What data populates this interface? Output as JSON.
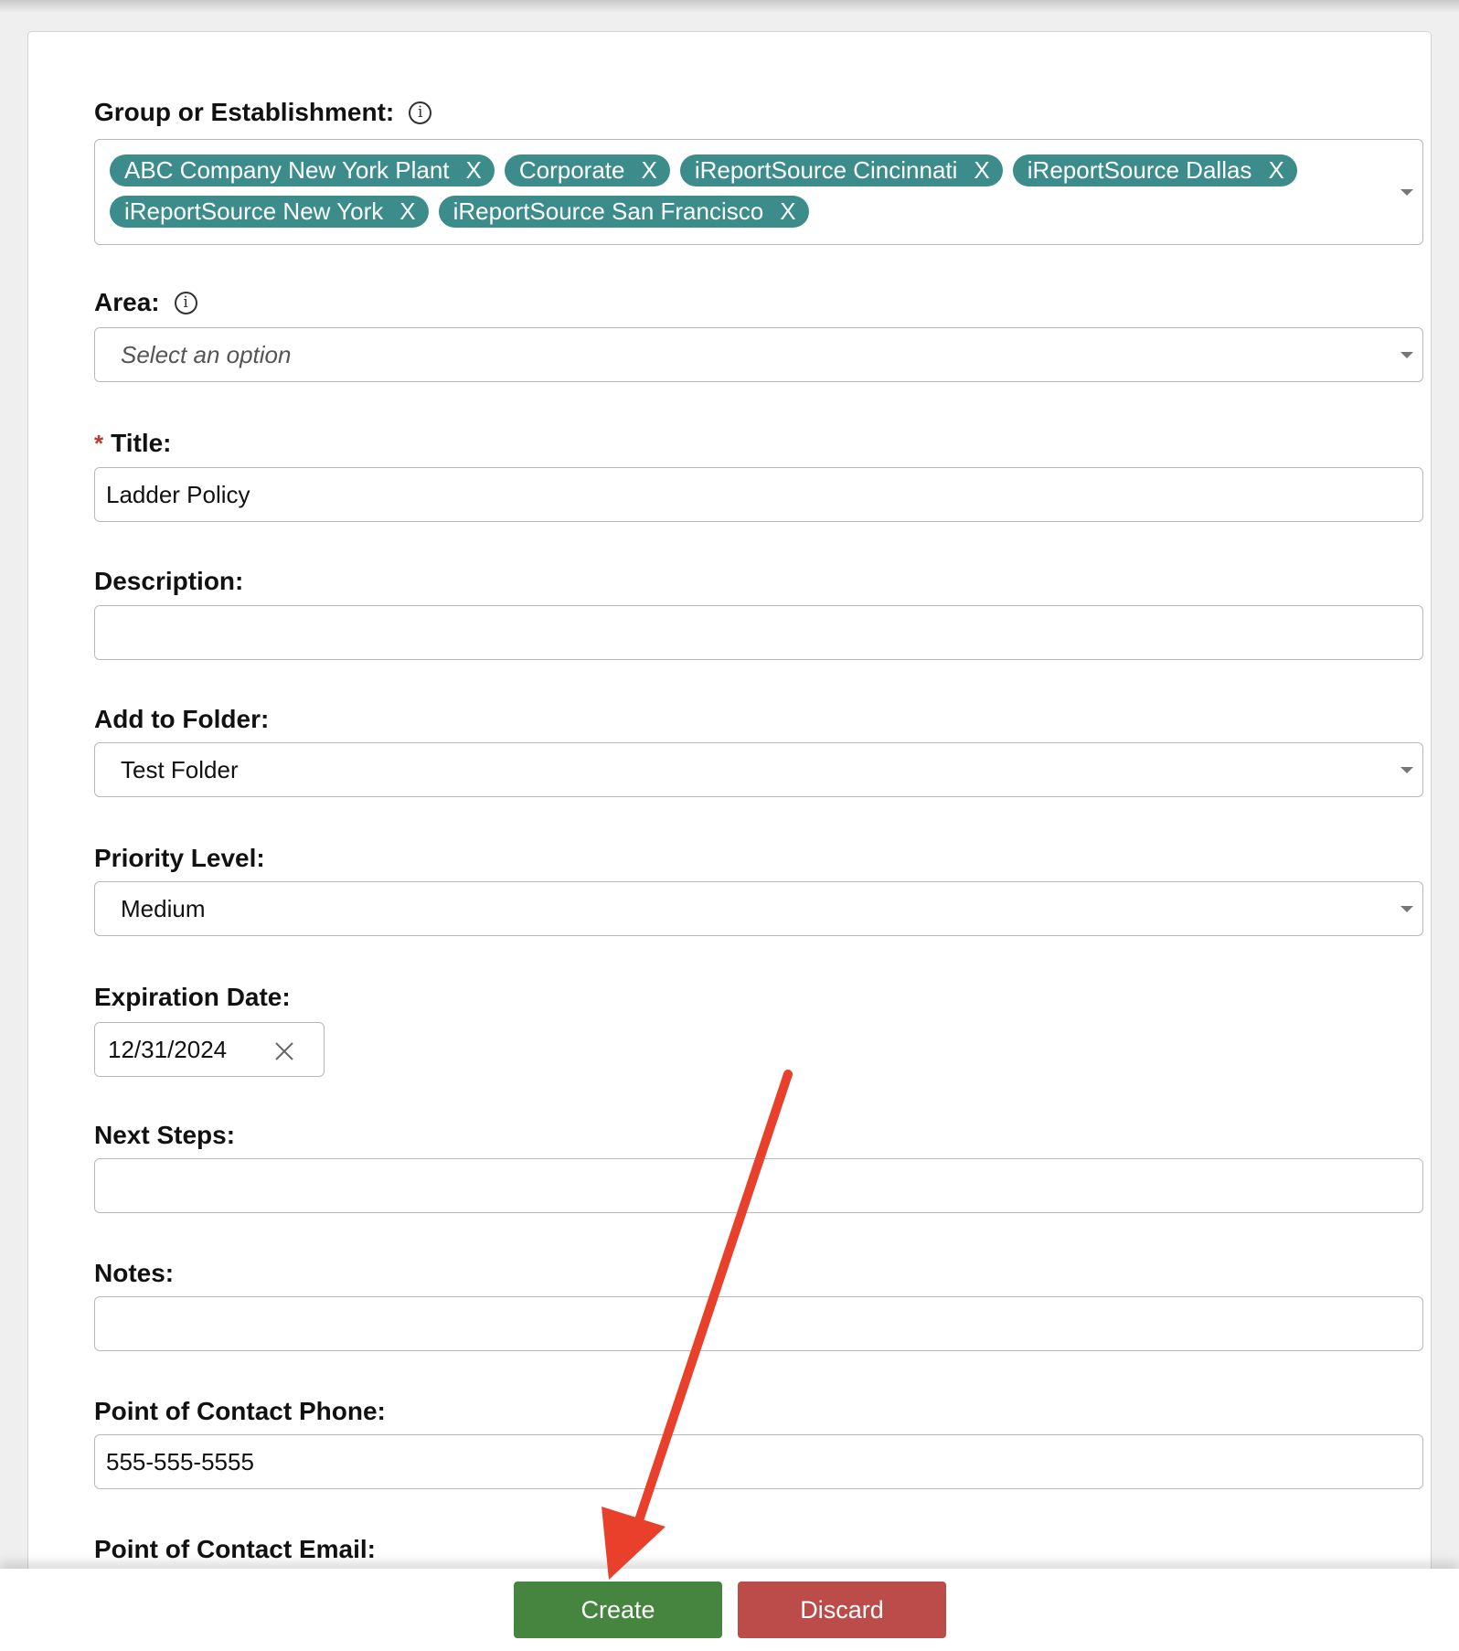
{
  "form": {
    "group": {
      "label": "Group or Establishment:",
      "info_icon": "info-icon",
      "chips": [
        {
          "label": "ABC Company New York Plant",
          "remove": "X"
        },
        {
          "label": "Corporate",
          "remove": "X"
        },
        {
          "label": "iReportSource Cincinnati",
          "remove": "X"
        },
        {
          "label": "iReportSource Dallas",
          "remove": "X"
        },
        {
          "label": "iReportSource New York",
          "remove": "X"
        },
        {
          "label": "iReportSource San Francisco",
          "remove": "X"
        }
      ]
    },
    "area": {
      "label": "Area:",
      "placeholder": "Select an option",
      "info_icon": "info-icon"
    },
    "title": {
      "required_mark": "*",
      "label": "Title:",
      "value": "Ladder Policy"
    },
    "description": {
      "label": "Description:",
      "value": ""
    },
    "folder": {
      "label": "Add to Folder:",
      "value": "Test Folder"
    },
    "priority": {
      "label": "Priority Level:",
      "value": "Medium"
    },
    "expiration": {
      "label": "Expiration Date:",
      "value": "12/31/2024",
      "clear_icon": "close-icon"
    },
    "next_steps": {
      "label": "Next Steps:",
      "value": ""
    },
    "notes": {
      "label": "Notes:",
      "value": ""
    },
    "contact_phone": {
      "label": "Point of Contact Phone:",
      "value": "555-555-5555"
    },
    "contact_email": {
      "label": "Point of Contact Email:",
      "value": ""
    }
  },
  "actions": {
    "create": "Create",
    "discard": "Discard"
  },
  "annotation": {
    "arrow_color": "#e8402a",
    "points_to": "create-button"
  },
  "colors": {
    "chip": "#3d8c8c",
    "create": "#468540",
    "discard": "#bc4c4a",
    "required": "#c0392b"
  }
}
